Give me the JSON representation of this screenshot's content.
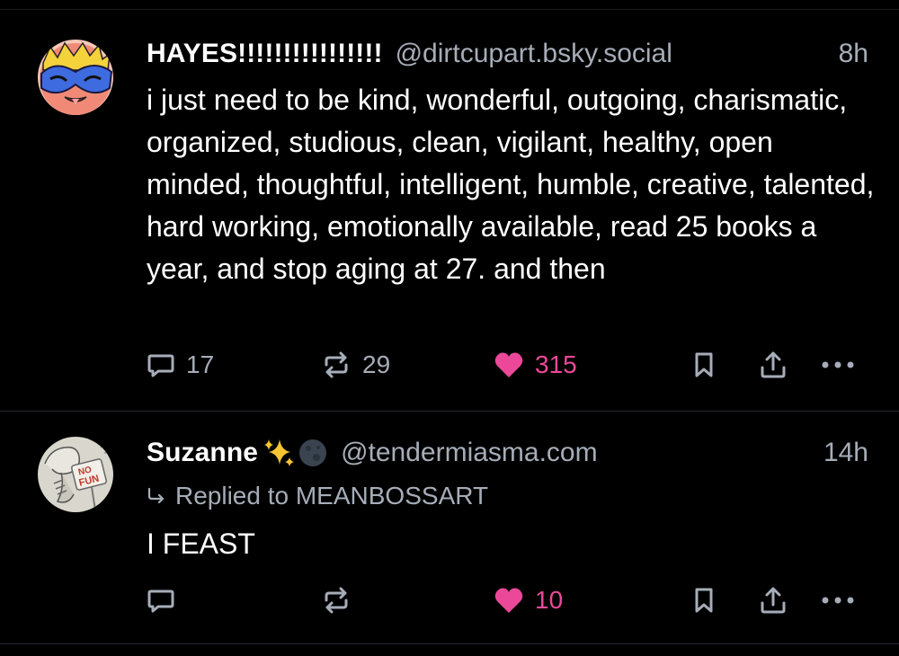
{
  "posts": [
    {
      "display_name": "HAYES!!!!!!!!!!!!!!!!",
      "handle": "@dirtcupart.bsky.social",
      "time": "8h",
      "avatar_icon": "cartoon-face-with-blue-mask-avatar",
      "text": "i just need to be kind, wonderful, outgoing, charismatic, organized, studious, clean, vigilant, healthy, open minded, thoughtful, intelligent, humble, creative, talented, hard working, emotionally available, read 25 books a year, and stop aging at 27. and then",
      "replies": "17",
      "reposts": "29",
      "likes": "315",
      "liked": true
    },
    {
      "display_name": "Suzanne",
      "name_emojis": [
        "sparkles-emoji",
        "dark-moon-emoji"
      ],
      "handle": "@tendermiasma.com",
      "time": "14h",
      "avatar_icon": "no-fun-sign-sketch-avatar",
      "reply_to": "Replied to MEANBOSSART",
      "text": "I FEAST",
      "replies": "",
      "reposts": "",
      "likes": "10",
      "liked": true
    }
  ],
  "colors": {
    "background": "#000000",
    "text": "#ffffff",
    "muted": "#a6adb8",
    "like_pink": "#ec4899",
    "divider": "#24272c"
  }
}
